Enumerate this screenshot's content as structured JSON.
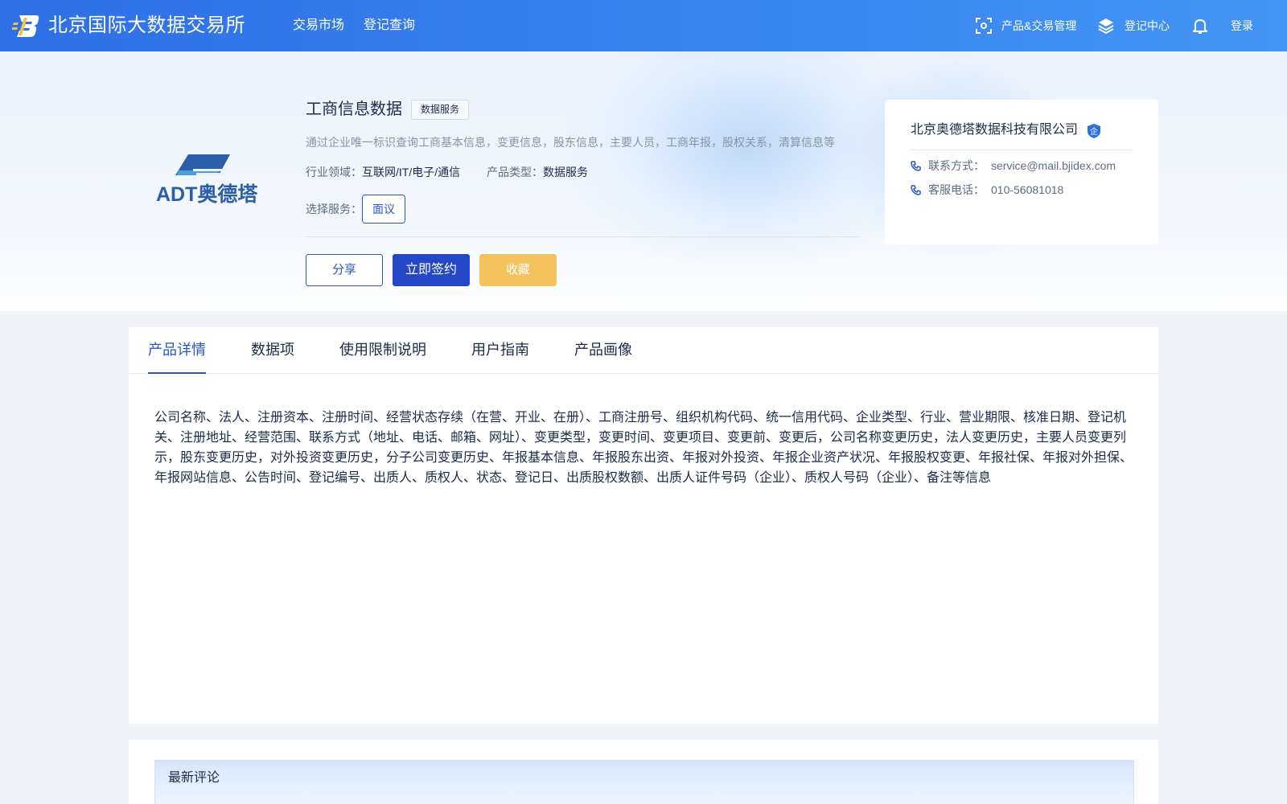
{
  "header": {
    "site_title": "北京国际大数据交易所",
    "nav": [
      "交易市场",
      "登记查询"
    ],
    "product_mgmt_label": "产品&交易管理",
    "registry_center_label": "登记中心",
    "login_label": "登录",
    "icons": [
      "bjidex-logo-icon",
      "scan-icon",
      "layers-icon",
      "bell-icon"
    ]
  },
  "colors": {
    "brand_blue": "#2a55c7",
    "primary_button": "#2347c6",
    "favorite_button": "#f5c35e",
    "topbar": "#3a86f0"
  },
  "product": {
    "logo_text": "ADT奥德塔",
    "title": "工商信息数据",
    "tag": "数据服务",
    "description": "通过企业唯一标识查询工商基本信息，变更信息，股东信息，主要人员，工商年报，股权关系，清算信息等",
    "industry_label": "行业领域：",
    "industry_value": "互联网/IT/电子/通信",
    "type_label": "产品类型：",
    "type_value": "数据服务",
    "service_label": "选择服务：",
    "service_option": "面议",
    "share_button": "分享",
    "sign_button": "立即签约",
    "favorite_button": "收藏"
  },
  "seller": {
    "name": "北京奥德塔数据科技有限公司",
    "badge": "企",
    "contact_label": "联系方式：",
    "contact_value": "service@mail.bjidex.com",
    "phone_label": "客服电话：",
    "phone_value": "010-56081018"
  },
  "tabs": {
    "items": [
      "产品详情",
      "数据项",
      "使用限制说明",
      "用户指南",
      "产品画像"
    ],
    "active": "产品详情"
  },
  "detail": {
    "text": "公司名称、法人、注册资本、注册时间、经营状态存续（在营、开业、在册）、工商注册号、组织机构代码、统一信用代码、企业类型、行业、营业期限、核准日期、登记机关、注册地址、经营范围、联系方式（地址、电话、邮箱、网址）、变更类型，变更时间、变更项目、变更前、变更后，公司名称变更历史，法人变更历史，主要人员变更列示，股东变更历史，对外投资变更历史，分子公司变更历史、年报基本信息、年报股东出资、年报对外投资、年报企业资产状况、年报股权变更、年报社保、年报对外担保、年报网站信息、公告时间、登记编号、出质人、质权人、状态、登记日、出质股权数额、出质人证件号码（企业）、质权人号码（企业）、备注等信息"
  },
  "comments": {
    "title": "最新评论"
  }
}
